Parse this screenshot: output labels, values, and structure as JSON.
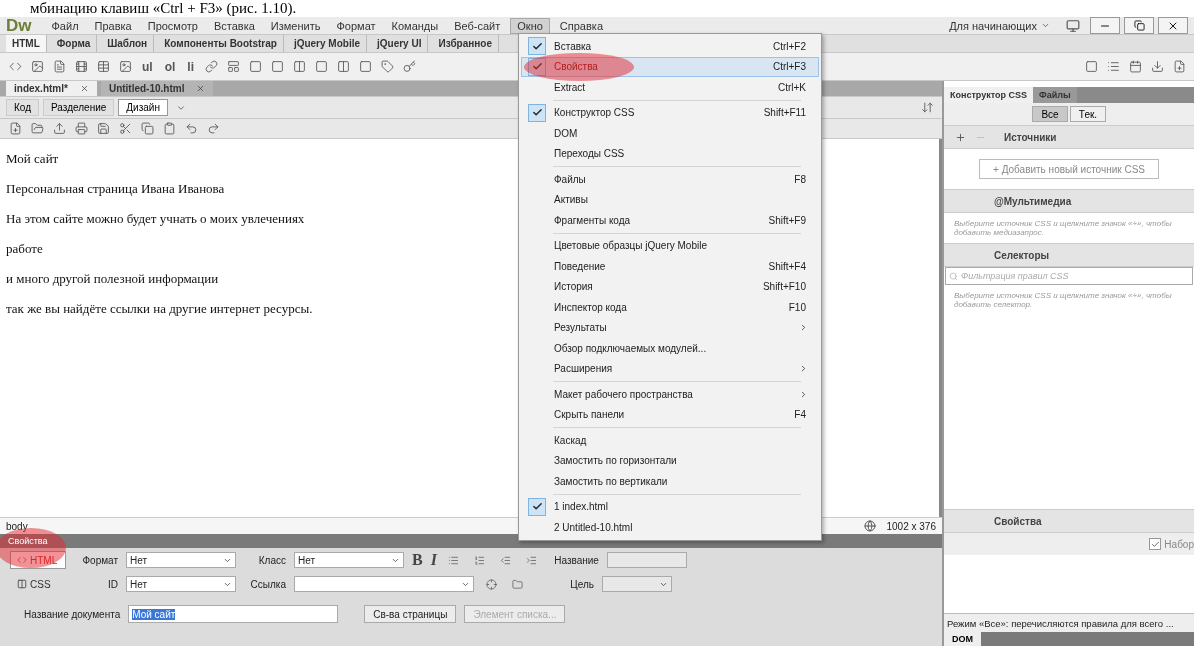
{
  "caption": "мбинацию клавиш «Ctrl + F3» (рис. 1.10).",
  "app": {
    "logo": "Dw",
    "workspace": "Для начинающих"
  },
  "menubar": [
    {
      "label": "Файл",
      "selected": false
    },
    {
      "label": "Правка",
      "selected": false
    },
    {
      "label": "Просмотр",
      "selected": false
    },
    {
      "label": "Вставка",
      "selected": false
    },
    {
      "label": "Изменить",
      "selected": false
    },
    {
      "label": "Формат",
      "selected": false
    },
    {
      "label": "Команды",
      "selected": false
    },
    {
      "label": "Веб-сайт",
      "selected": false
    },
    {
      "label": "Окно",
      "selected": true
    },
    {
      "label": "Справка",
      "selected": false
    }
  ],
  "insert_tabs": [
    {
      "label": "HTML",
      "selected": true
    },
    {
      "label": "Форма",
      "selected": false
    },
    {
      "label": "Шаблон",
      "selected": false
    },
    {
      "label": "Компоненты Bootstrap",
      "selected": false
    },
    {
      "label": "jQuery Mobile",
      "selected": false
    },
    {
      "label": "jQuery UI",
      "selected": false
    },
    {
      "label": "Избранное",
      "selected": false
    }
  ],
  "insert_toolbar": {
    "texts": [
      "ul",
      "ol",
      "li"
    ]
  },
  "doc_tabs": [
    {
      "label": "index.html*",
      "selected": true
    },
    {
      "label": "Untitled-10.html",
      "selected": false
    }
  ],
  "view_buttons": [
    {
      "label": "Код",
      "selected": false
    },
    {
      "label": "Разделение",
      "selected": false
    },
    {
      "label": "Дизайн",
      "selected": true
    }
  ],
  "document": {
    "paragraphs": [
      "Мой сайт",
      "Персональная страница Ивана Иванова",
      "На этом сайте можно будет учнать о моих увлечениях",
      "работе",
      "и много другой полезной информации",
      "так же вы найдёте ссылки на другие интернет ресурсы."
    ]
  },
  "status_bar": {
    "tag": "body",
    "size": "1002 x 376"
  },
  "window_menu": {
    "groups": [
      [
        {
          "label": "Вставка",
          "shortcut": "Ctrl+F2",
          "checked": true,
          "selected": false,
          "submenu": false,
          "highlighted": false
        },
        {
          "label": "Свойства",
          "shortcut": "Ctrl+F3",
          "checked": true,
          "selected": true,
          "submenu": false,
          "highlighted": true
        },
        {
          "label": "Extract",
          "shortcut": "Ctrl+K",
          "checked": false,
          "selected": false,
          "submenu": false,
          "highlighted": false
        }
      ],
      [
        {
          "label": "Конструктор CSS",
          "shortcut": "Shift+F11",
          "checked": true,
          "selected": false,
          "submenu": false,
          "highlighted": false
        },
        {
          "label": "DOM",
          "checked": false,
          "selected": false,
          "submenu": false,
          "highlighted": false
        },
        {
          "label": "Переходы CSS",
          "checked": false,
          "selected": false,
          "submenu": false,
          "highlighted": false
        }
      ],
      [
        {
          "label": "Файлы",
          "shortcut": "F8",
          "checked": false,
          "selected": false,
          "submenu": false,
          "highlighted": false
        },
        {
          "label": "Активы",
          "checked": false,
          "selected": false,
          "submenu": false,
          "highlighted": false
        },
        {
          "label": "Фрагменты кода",
          "shortcut": "Shift+F9",
          "checked": false,
          "selected": false,
          "submenu": false,
          "highlighted": false
        }
      ],
      [
        {
          "label": "Цветовые образцы jQuery Mobile",
          "checked": false,
          "selected": false,
          "submenu": false,
          "highlighted": false
        },
        {
          "label": "Поведение",
          "shortcut": "Shift+F4",
          "checked": false,
          "selected": false,
          "submenu": false,
          "highlighted": false
        },
        {
          "label": "История",
          "shortcut": "Shift+F10",
          "checked": false,
          "selected": false,
          "submenu": false,
          "highlighted": false
        },
        {
          "label": "Инспектор кода",
          "shortcut": "F10",
          "checked": false,
          "selected": false,
          "submenu": false,
          "highlighted": false
        },
        {
          "label": "Результаты",
          "checked": false,
          "selected": false,
          "submenu": true,
          "highlighted": false
        },
        {
          "label": "Обзор подключаемых модулей...",
          "checked": false,
          "selected": false,
          "submenu": false,
          "highlighted": false
        },
        {
          "label": "Расширения",
          "checked": false,
          "selected": false,
          "submenu": true,
          "highlighted": false
        }
      ],
      [
        {
          "label": "Макет рабочего пространства",
          "checked": false,
          "selected": false,
          "submenu": true,
          "highlighted": false
        },
        {
          "label": "Скрыть панели",
          "shortcut": "F4",
          "checked": false,
          "selected": false,
          "submenu": false,
          "highlighted": false
        }
      ],
      [
        {
          "label": "Каскад",
          "checked": false,
          "selected": false,
          "submenu": false,
          "highlighted": false
        },
        {
          "label": "Замостить по горизонтали",
          "checked": false,
          "selected": false,
          "submenu": false,
          "highlighted": false
        },
        {
          "label": "Замостить по вертикали",
          "checked": false,
          "selected": false,
          "submenu": false,
          "highlighted": false
        }
      ],
      [
        {
          "label": "1 index.html",
          "checked": true,
          "selected": false,
          "submenu": false,
          "highlighted": false
        },
        {
          "label": "2 Untitled-10.html",
          "checked": false,
          "selected": false,
          "submenu": false,
          "highlighted": false
        }
      ]
    ]
  },
  "properties": {
    "title": "Свойства",
    "title_highlighted": true,
    "modes": [
      {
        "label": "HTML",
        "selected": true
      },
      {
        "label": "CSS",
        "selected": false
      }
    ],
    "format_label": "Формат",
    "format_value": "Нет",
    "class_label": "Класс",
    "class_value": "Нет",
    "bold": "B",
    "italic": "I",
    "title_label": "Название",
    "id_label": "ID",
    "id_value": "Нет",
    "link_label": "Ссылка",
    "target_label": "Цель",
    "doc_title_label": "Название документа",
    "doc_title_value": "Мой сайт",
    "page_props_button": "Св-ва страницы",
    "list_item_button": "Элемент списка..."
  },
  "css_panel": {
    "tabs": [
      {
        "label": "Конструктор CSS",
        "selected": true
      },
      {
        "label": "Файлы",
        "selected": false
      }
    ],
    "filters": [
      {
        "label": "Все",
        "selected": true
      },
      {
        "label": "Тек.",
        "selected": false
      }
    ],
    "sources_title": "Источники",
    "add_source": "+ Добавить новый источник CSS",
    "media_title": "@Мультимедиа",
    "media_hint": "Выберите источник CSS и щелкните значок «+», чтобы добавить медиазапрос.",
    "selectors_title": "Селекторы",
    "filter_placeholder": "Фильтрация правил CSS",
    "selectors_hint": "Выберите источник CSS и щелкните значок «+», чтобы добавить селектор.",
    "properties_title": "Свойства",
    "set_label": "Набор",
    "set_checked": true,
    "mode_note": "Режим «Все»: перечисляются правила для всего ...",
    "bottom_tab": "DOM"
  }
}
